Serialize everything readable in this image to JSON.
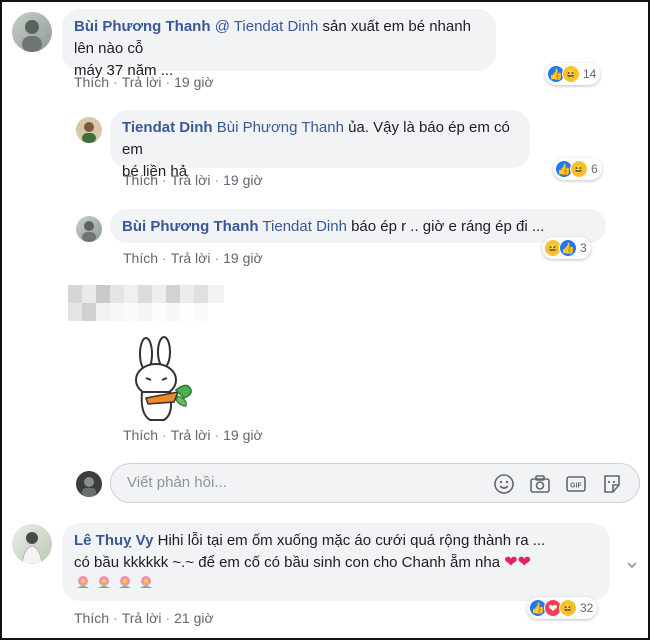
{
  "comments": [
    {
      "author": "Bùi Phương Thanh",
      "mention": "@ Tiendat Dinh",
      "text_line1": " sản xuất em bé nhanh lên nào cỗ",
      "text_line2": "máy 37 năm ...",
      "actions": {
        "like": "Thích",
        "reply": "Trả lời",
        "time": "19 giờ"
      },
      "reactions": {
        "icons": [
          "like",
          "haha"
        ],
        "count": "14"
      }
    },
    {
      "author": "Tiendat Dinh",
      "mention": "Bùi Phương Thanh",
      "text_line1": " ủa. Vậy là báo ép em có em",
      "text_line2": "bé liền hả",
      "actions": {
        "like": "Thích",
        "reply": "Trả lời",
        "time": "19 giờ"
      },
      "reactions": {
        "icons": [
          "like",
          "haha"
        ],
        "count": "6"
      }
    },
    {
      "author": "Bùi Phương Thanh",
      "mention": "Tiendat Dinh",
      "text_line1": " báo ép r .. giờ e ráng ép đi ...",
      "actions": {
        "like": "Thích",
        "reply": "Trả lời",
        "time": "19 giờ"
      },
      "reactions": {
        "icons": [
          "haha",
          "like"
        ],
        "count": "3"
      }
    },
    {
      "actions": {
        "like": "Thích",
        "reply": "Trả lời",
        "time": "19 giờ"
      }
    },
    {
      "author": "Lê Thuỵ Vy",
      "text_line1": " Hihi lỗi tại em ốm xuống mặc áo cưới quá rộng thành ra ...",
      "text_line2": "có bầu kkkkkk ~.~ để em cố có bầu sinh con cho Chanh ẵm nha",
      "actions": {
        "like": "Thích",
        "reply": "Trả lời",
        "time": "21 giờ"
      },
      "reactions": {
        "icons": [
          "like",
          "love",
          "haha"
        ],
        "count": "32"
      }
    }
  ],
  "reply_box": {
    "placeholder": "Viết phản hồi..."
  },
  "icons": {
    "emoji": "smile-icon",
    "camera": "camera-icon",
    "gif": "gif-icon",
    "sticker": "sticker-icon"
  },
  "colors": {
    "link": "#385898",
    "bubble": "#f2f3f5",
    "like": "#2078f4",
    "love": "#f33e58",
    "haha": "#f7c42f"
  }
}
